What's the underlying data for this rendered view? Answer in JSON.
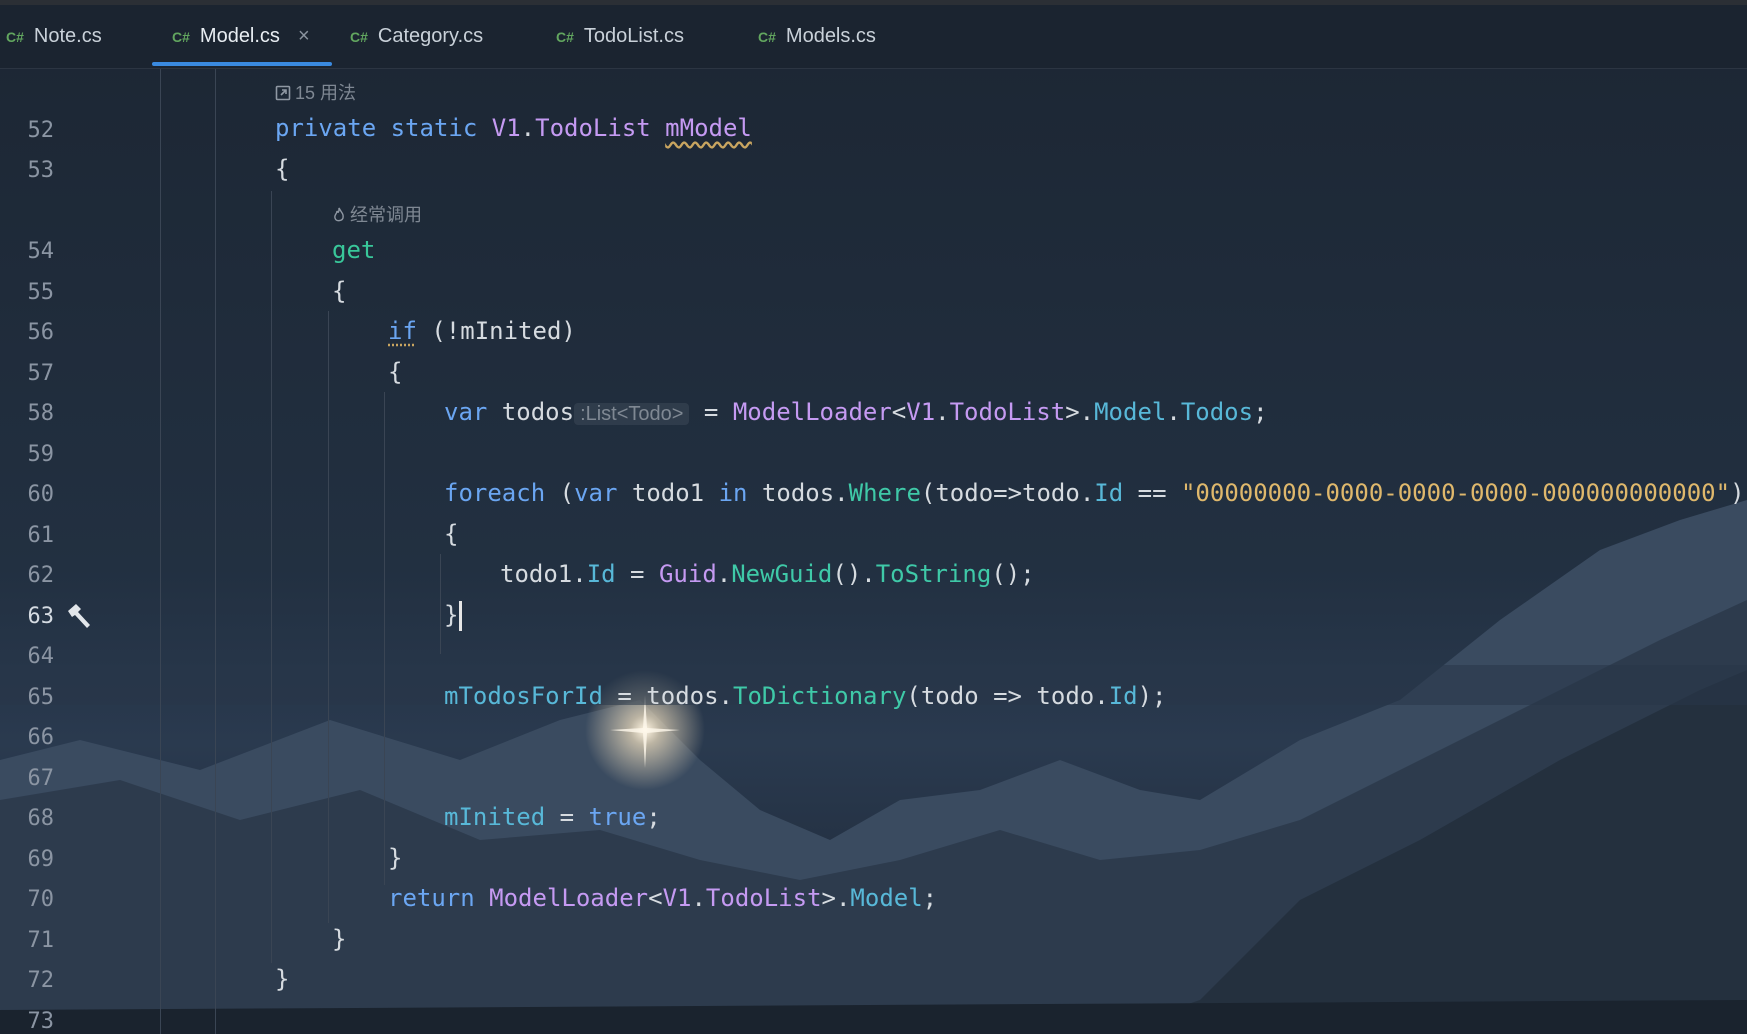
{
  "editor_tabs": [
    {
      "lang": "C#",
      "name": "Note.cs",
      "active": false
    },
    {
      "lang": "C#",
      "name": "Model.cs",
      "active": true,
      "close": "×"
    },
    {
      "lang": "C#",
      "name": "Category.cs",
      "active": false
    },
    {
      "lang": "C#",
      "name": "TodoList.cs",
      "active": false
    },
    {
      "lang": "C#",
      "name": "Models.cs",
      "active": false
    }
  ],
  "hints": {
    "usages": "15 用法",
    "frequent": "经常调用"
  },
  "inlay_type": ":List<Todo>",
  "line_numbers": [
    "52",
    "53",
    "54",
    "55",
    "56",
    "57",
    "58",
    "59",
    "60",
    "61",
    "62",
    "63",
    "64",
    "65",
    "66",
    "67",
    "68",
    "69",
    "70",
    "71",
    "72",
    "73"
  ],
  "current_line": "63",
  "code": {
    "l52": {
      "kw1": "private",
      "kw2": "static",
      "ns": "V1",
      "dot": ".",
      "type": "TodoList",
      "name": "mModel"
    },
    "l53": "{",
    "l54": "get",
    "l55": "{",
    "l56": {
      "kw": "if",
      "rest": " (!mInited)"
    },
    "l57": "{",
    "l58": {
      "kw": "var",
      "name": " todos",
      "eq": " = ",
      "t1": "ModelLoader",
      "lt": "<",
      "ns": "V1",
      "d1": ".",
      "t2": "TodoList",
      "gt": ">",
      "d2": ".",
      "m1": "Model",
      "d3": ".",
      "m2": "Todos",
      "end": ";"
    },
    "l60": {
      "kw1": "foreach",
      "p1": " (",
      "kw2": "var",
      "v": " todo1 ",
      "kw3": "in",
      "s1": " todos.",
      "fn": "Where",
      "s2": "(todo=>todo.",
      "m": "Id",
      "s3": " == ",
      "str": "\"00000000-0000-0000-0000-000000000000\"",
      "s4": "))"
    },
    "l61": "{",
    "l62": {
      "s1": "todo1.",
      "m": "Id",
      "s2": " = ",
      "t": "Guid",
      "d": ".",
      "f1": "NewGuid",
      "s3": "().",
      "f2": "ToString",
      "s4": "();"
    },
    "l63": "}",
    "l65": {
      "m": "mTodosForId",
      "s1": " = todos.",
      "fn": "ToDictionary",
      "s2": "(todo => todo.",
      "m2": "Id",
      "s3": ");"
    },
    "l68": {
      "m": "mInited",
      "s1": " = ",
      "kw": "true",
      "s2": ";"
    },
    "l69": "}",
    "l70": {
      "kw": "return",
      "s": " ",
      "t1": "ModelLoader",
      "lt": "<",
      "ns": "V1",
      "d1": ".",
      "t2": "TodoList",
      "gt": ">",
      "d2": ".",
      "m": "Model",
      "end": ";"
    },
    "l71": "}",
    "l72": "}"
  },
  "colors": {
    "keyword": "#6ba6f2",
    "type": "#c59af2",
    "member": "#58b8d8",
    "method": "#3fc9a8",
    "string": "#dfb86c",
    "tab_underline": "#3a8ae0"
  },
  "icons": [
    "external-link-icon",
    "flame-icon",
    "hammer-icon",
    "csharp-file-icon"
  ]
}
